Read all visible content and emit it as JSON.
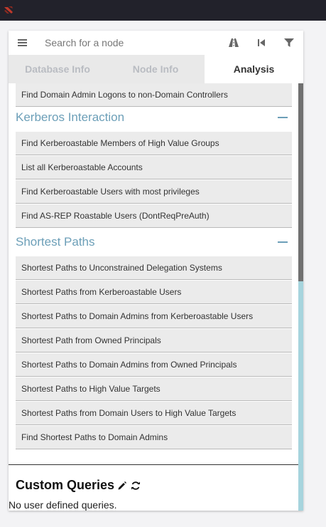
{
  "search": {
    "placeholder": "Search for a node"
  },
  "tabs": [
    {
      "label": "Database Info"
    },
    {
      "label": "Node Info"
    },
    {
      "label": "Analysis"
    }
  ],
  "top_items": [
    "Find Domain Admin Logons to non-Domain Controllers"
  ],
  "kerberos": {
    "title": "Kerberos Interaction",
    "items": [
      "Find Kerberoastable Members of High Value Groups",
      "List all Kerberoastable Accounts",
      "Find Kerberoastable Users with most privileges",
      "Find AS-REP Roastable Users (DontReqPreAuth)"
    ]
  },
  "shortest": {
    "title": "Shortest Paths",
    "items": [
      "Shortest Paths to Unconstrained Delegation Systems",
      "Shortest Paths from Kerberoastable Users",
      "Shortest Paths to Domain Admins from Kerberoastable Users",
      "Shortest Path from Owned Principals",
      "Shortest Paths to Domain Admins from Owned Principals",
      "Shortest Paths to High Value Targets",
      "Shortest Paths from Domain Users to High Value Targets",
      "Find Shortest Paths to Domain Admins"
    ]
  },
  "custom": {
    "title": "Custom Queries",
    "empty_text": "No user defined queries."
  },
  "colors": {
    "topbar": "#22222b",
    "accent": "#6c9fb8",
    "logo": "#c0392b"
  },
  "icons": [
    "menu-icon",
    "road-icon",
    "step-back-icon",
    "filter-icon",
    "pencil-icon",
    "refresh-icon",
    "logo-icon"
  ]
}
